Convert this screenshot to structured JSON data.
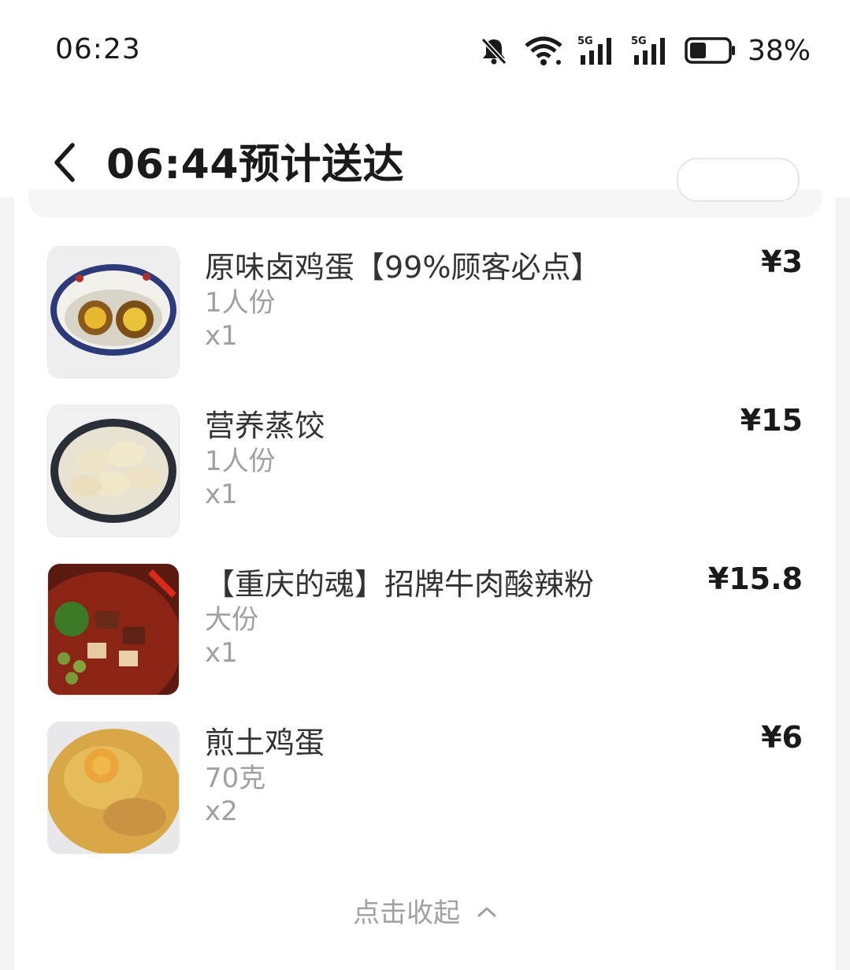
{
  "status_bar": {
    "time": "06:23",
    "battery_percent": "38%",
    "icons": [
      "bell-muted-icon",
      "wifi-icon",
      "signal-5g-icon",
      "signal-5g-icon",
      "battery-icon"
    ]
  },
  "header": {
    "title": "06:44预计送达",
    "back_icon": "chevron-left-icon"
  },
  "order_items": [
    {
      "name": "原味卤鸡蛋【99%顾客必点】",
      "spec": "1人份",
      "qty": "x1",
      "price": "¥3",
      "image": "braised-eggs-bowl"
    },
    {
      "name": "营养蒸饺",
      "spec": "1人份",
      "qty": "x1",
      "price": "¥15",
      "image": "steamed-dumplings-plate"
    },
    {
      "name": "【重庆的魂】招牌牛肉酸辣粉",
      "spec": "大份",
      "qty": "x1",
      "price": "¥15.8",
      "image": "beef-hot-sour-noodles"
    },
    {
      "name": "煎土鸡蛋",
      "spec": "70克",
      "qty": "x2",
      "price": "¥6",
      "image": "fried-egg"
    }
  ],
  "collapse": {
    "label": "点击收起",
    "icon": "chevron-up-icon"
  },
  "colors": {
    "background": "#f4f4f4",
    "card": "#ffffff",
    "primary_text": "#1a1a1a",
    "secondary_text": "#a0a0a0"
  }
}
